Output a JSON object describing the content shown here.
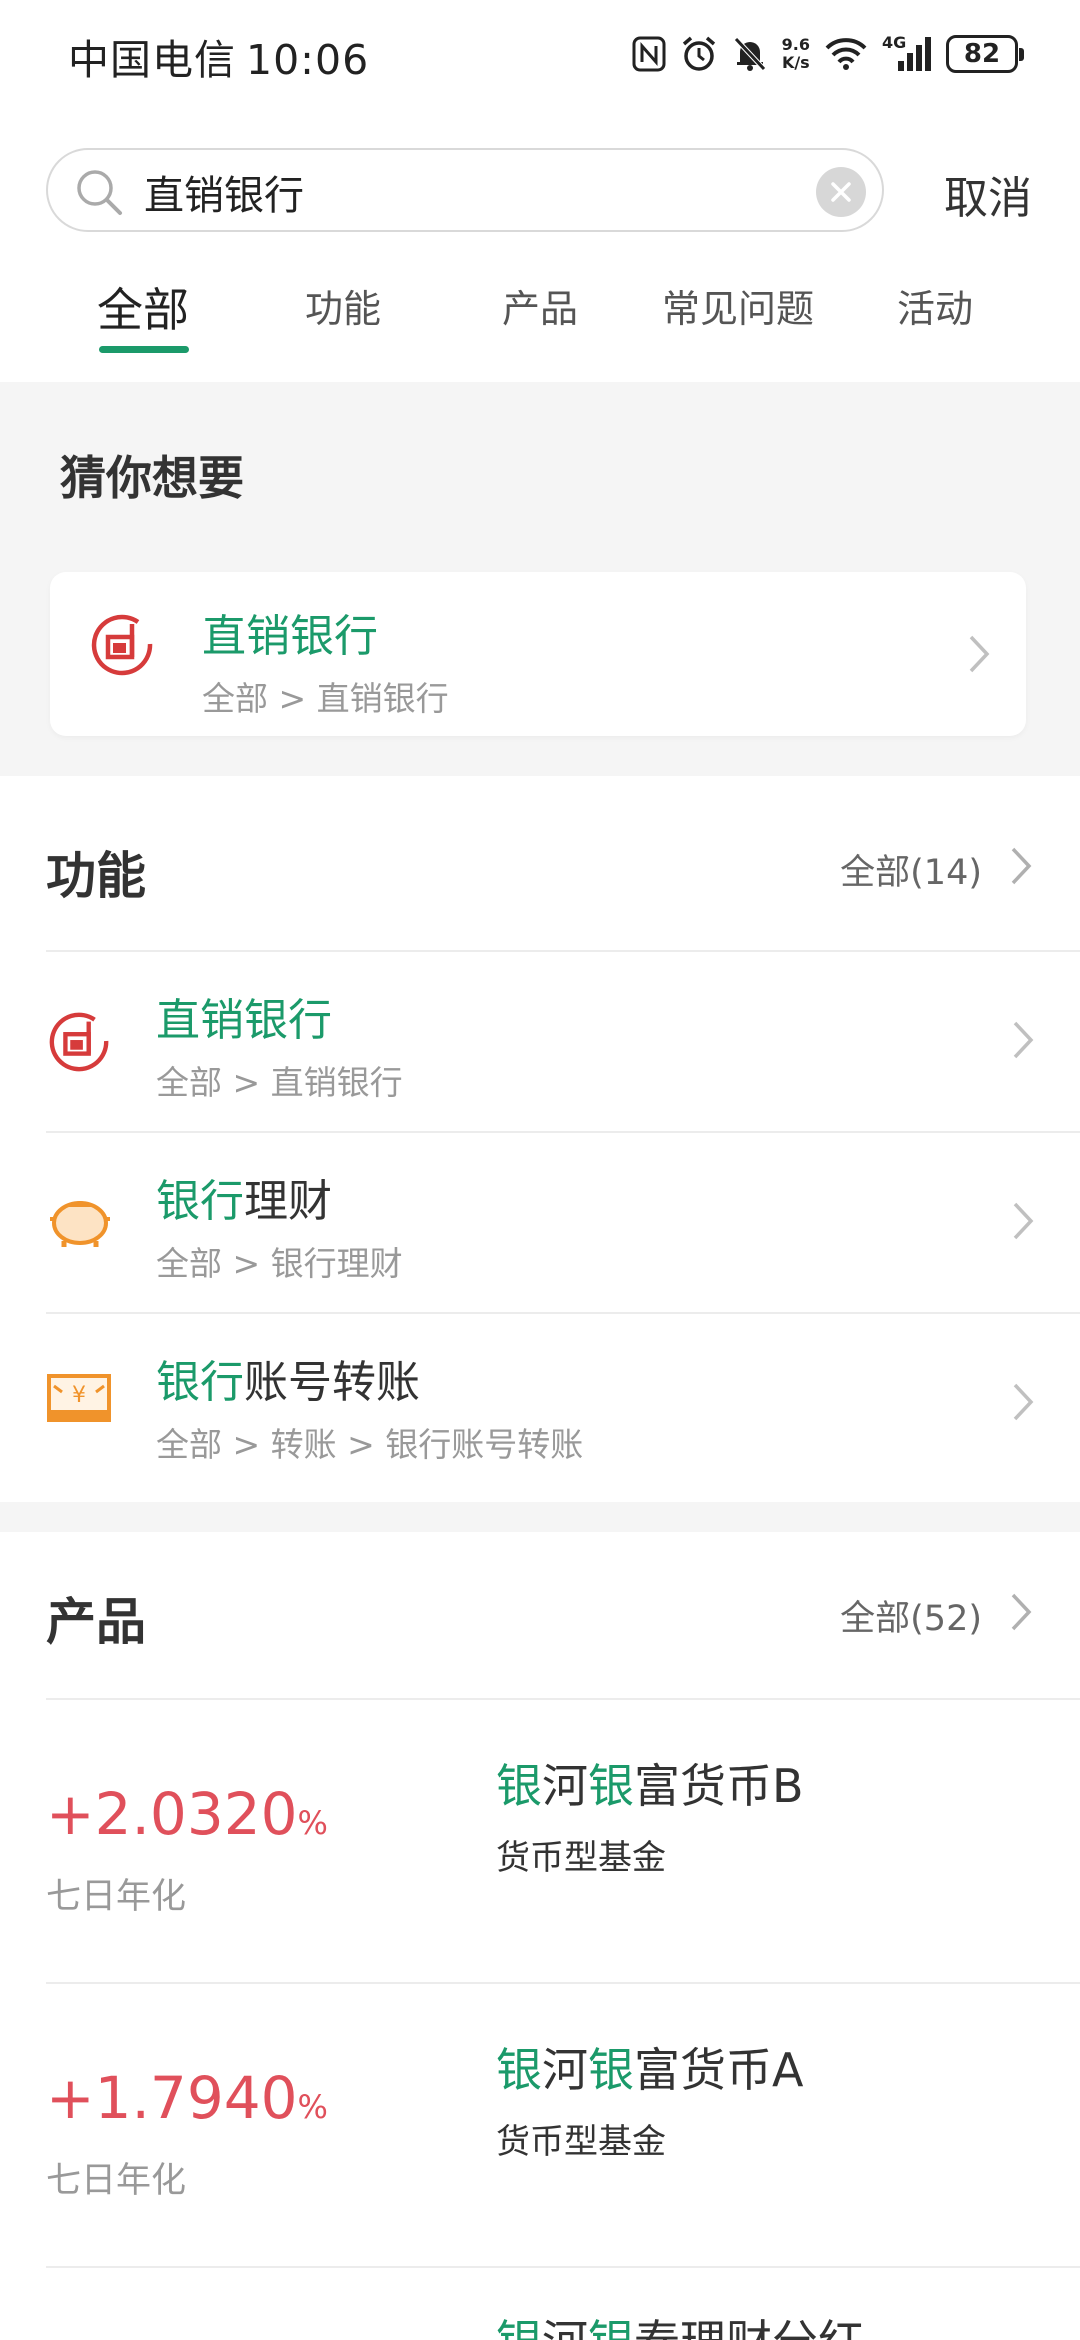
{
  "status_bar": {
    "carrier": "中国电信",
    "time": "10:06",
    "net_speed_value": "9.6",
    "net_speed_unit": "K/s",
    "network": "4G",
    "battery": "82"
  },
  "search": {
    "value": "直销银行",
    "placeholder": "",
    "cancel_label": "取消"
  },
  "tabs": [
    {
      "label": "全部",
      "active": true
    },
    {
      "label": "功能",
      "active": false
    },
    {
      "label": "产品",
      "active": false
    },
    {
      "label": "常见问题",
      "active": false
    },
    {
      "label": "活动",
      "active": false
    }
  ],
  "guess": {
    "title": "猜你想要",
    "item": {
      "title": "直销银行",
      "path": "全部 > 直销银行",
      "icon": "direct-bank-icon"
    }
  },
  "functions": {
    "title": "功能",
    "more": "全部(14)",
    "items": [
      {
        "title_hl": "直销银行",
        "title_rest": "",
        "path": "全部 > 直销银行",
        "icon": "direct-bank-icon"
      },
      {
        "title_hl": "银行",
        "title_rest": "理财",
        "path": "全部 > 银行理财",
        "icon": "piggy-bank-icon"
      },
      {
        "title_hl": "银行",
        "title_rest": "账号转账",
        "path": "全部 > 转账 > 银行账号转账",
        "icon": "transfer-icon"
      }
    ]
  },
  "products": {
    "title": "产品",
    "more": "全部(52)",
    "items": [
      {
        "rate": "+2.0320",
        "unit": "%",
        "rate_label": "七日年化",
        "name_parts": [
          "银",
          "河",
          "银",
          "富货币B"
        ],
        "type": "货币型基金"
      },
      {
        "rate": "+1.7940",
        "unit": "%",
        "rate_label": "七日年化",
        "name_parts": [
          "银",
          "河",
          "银",
          "富货币A"
        ],
        "type": "货币型基金"
      },
      {
        "rate": "",
        "unit": "",
        "rate_label": "",
        "name_parts": [
          "银",
          "河",
          "银",
          "泰理财分红"
        ],
        "type": ""
      }
    ]
  },
  "colors": {
    "accent_green": "#1b9a6a",
    "rate_red": "#e0505b",
    "icon_red": "#d63b3b",
    "icon_orange": "#f0932b"
  }
}
